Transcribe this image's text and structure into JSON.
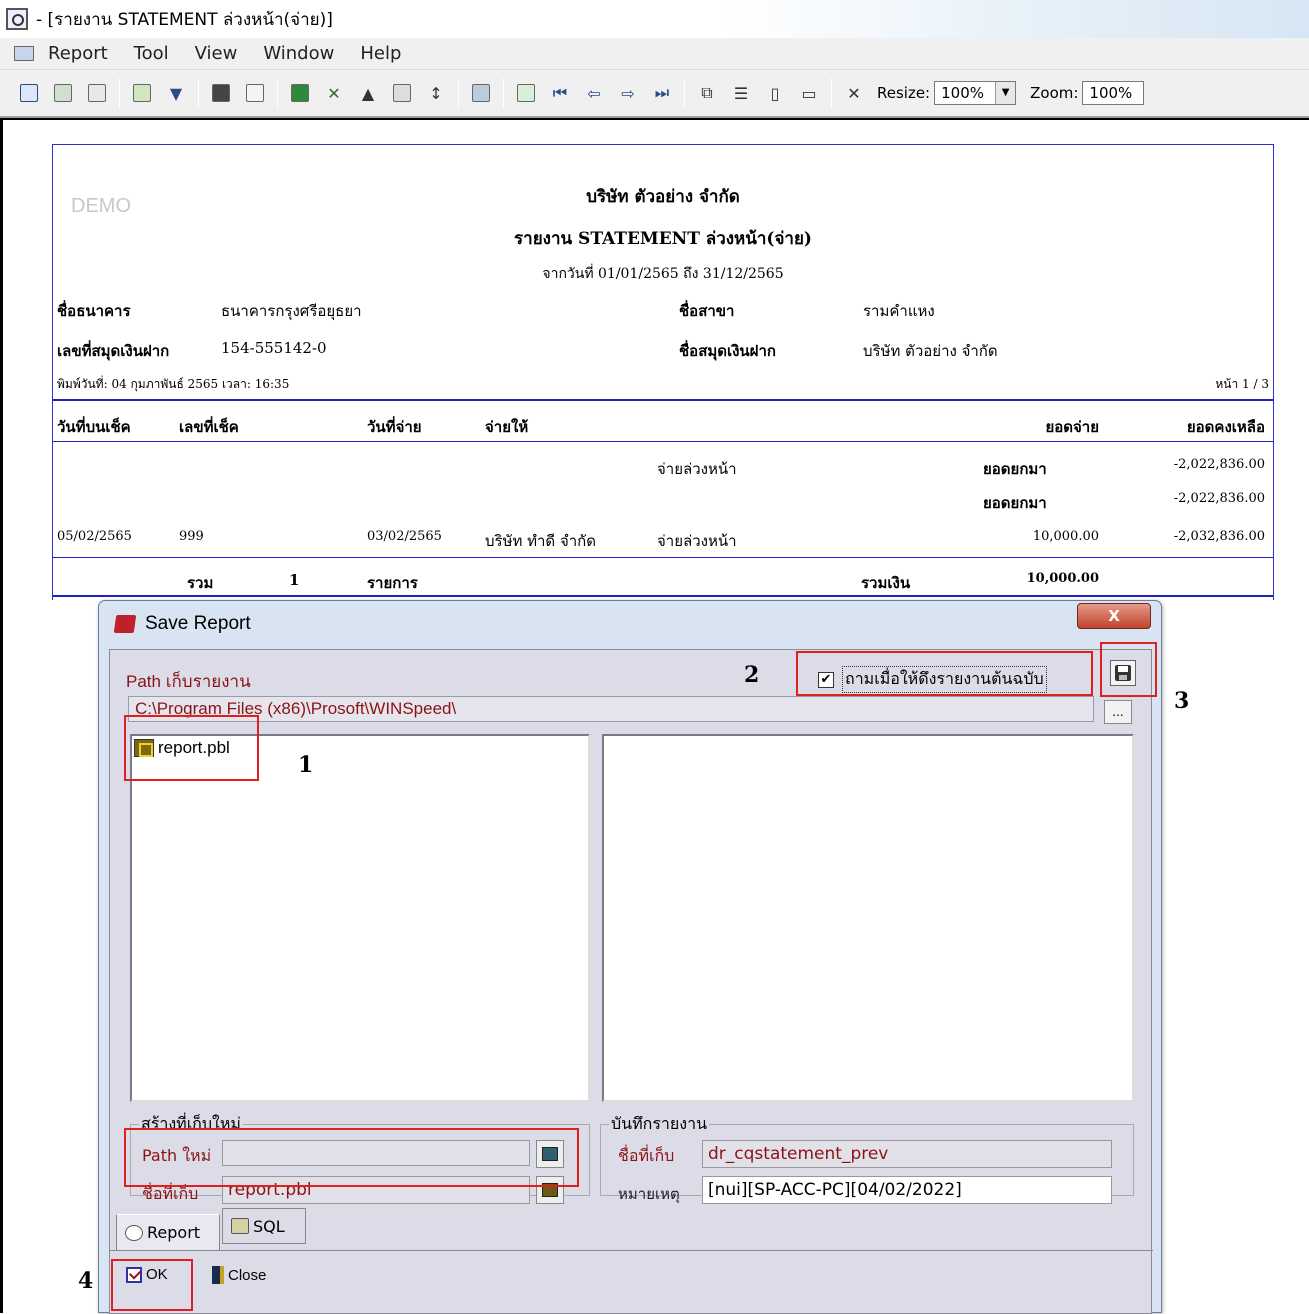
{
  "window": {
    "title": "- [รายงาน STATEMENT ล่วงหน้า(จ่าย)]"
  },
  "menu": [
    "Report",
    "Tool",
    "View",
    "Window",
    "Help"
  ],
  "toolbar": {
    "resize_label": "Resize:",
    "resize_value": "100%",
    "zoom_label": "Zoom:",
    "zoom_value": "100%"
  },
  "report": {
    "watermark": "DEMO",
    "company": "บริษัท ตัวอย่าง จำกัด",
    "title": "รายงาน STATEMENT ล่วงหน้า(จ่าย)",
    "date_range": "จากวันที่ 01/01/2565 ถึง 31/12/2565",
    "bank_label": "ชื่อธนาคาร",
    "bank_value": "ธนาคารกรุงศรีอยุธยา",
    "branch_label": "ชื่อสาขา",
    "branch_value": "รามคำแหง",
    "account_no_label": "เลขที่สมุดเงินฝาก",
    "account_no_value": "154-555142-0",
    "account_name_label": "ชื่อสมุดเงินฝาก",
    "account_name_value": "บริษัท ตัวอย่าง จำกัด",
    "printed": "พิมพ์วันที่: 04 กุมภาพันธ์ 2565 เวลา: 16:35",
    "page": "หน้า 1 / 3",
    "columns": {
      "cheque_date": "วันที่บนเช็ค",
      "cheque_no": "เลขที่เช็ค",
      "pay_date": "วันที่จ่าย",
      "pay_to": "จ่ายให้",
      "amount": "ยอดจ่าย",
      "balance": "ยอดคงเหลือ"
    },
    "rows": [
      {
        "desc": "จ่ายล่วงหน้า",
        "label": "ยอดยกมา",
        "balance": "-2,022,836.00"
      },
      {
        "label": "ยอดยกมา",
        "balance": "-2,022,836.00"
      },
      {
        "cheque_date": "05/02/2565",
        "cheque_no": "999",
        "pay_date": "03/02/2565",
        "pay_to": "บริษัท ทำดี จำกัด",
        "desc": "จ่ายล่วงหน้า",
        "amount": "10,000.00",
        "balance": "-2,032,836.00"
      }
    ],
    "total": {
      "label": "รวม",
      "count": "1",
      "items": "รายการ",
      "sum_label": "รวมเงิน",
      "sum_value": "10,000.00"
    }
  },
  "dialog": {
    "title": "Save Report",
    "close": "X",
    "path_label": "Path เก็บรายงาน",
    "path_value": "C:\\Program Files (x86)\\Prosoft\\WINSpeed\\",
    "browse": "...",
    "ask_checked": "✔",
    "ask_label": "ถามเมื่อให้ดึงรายงานต้นฉบับ",
    "file": "report.pbl",
    "new_group": {
      "legend": "สร้างที่เก็บใหม่",
      "path_label": "Path ใหม่",
      "path_value": "",
      "store_label": "ชื่อที่เก็บ",
      "store_value": "report.pbl"
    },
    "save_group": {
      "legend": "บันทึกรายงาน",
      "store_label": "ชื่อที่เก็บ",
      "store_value": "dr_cqstatement_prev",
      "note_label": "หมายเหตุ",
      "note_value": "[nui][SP-ACC-PC][04/02/2022]"
    },
    "tabs": [
      "Report",
      "SQL"
    ],
    "ok": "OK",
    "close_btn": "Close"
  },
  "annotations": [
    "1",
    "2",
    "3",
    "4"
  ],
  "colors": {
    "annotation_red": "#e02020",
    "label_dark_red": "#8a1414",
    "report_rule_blue": "#2020c0",
    "dialog_bg": "#d8e4f2"
  }
}
